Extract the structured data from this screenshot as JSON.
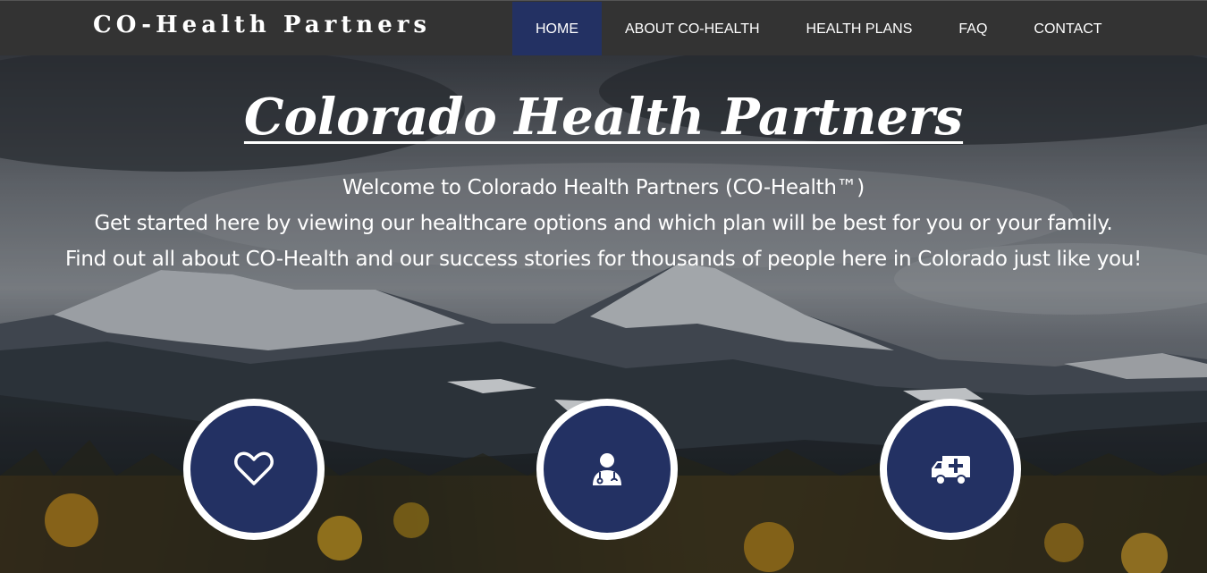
{
  "brand": {
    "name": "CO-Health Partners"
  },
  "nav": {
    "items": [
      {
        "label": "HOME",
        "active": true
      },
      {
        "label": "ABOUT CO-HEALTH"
      },
      {
        "label": "HEALTH PLANS"
      },
      {
        "label": "FAQ"
      },
      {
        "label": "CONTACT"
      }
    ]
  },
  "hero": {
    "title": "Colorado Health Partners",
    "lines": [
      "Welcome to Colorado Health Partners (CO-Health™)",
      "Get started here by viewing our healthcare options and which plan will be best for you or your family.",
      "Find out all about CO-Health and our success stories for thousands of people here in Colorado just like you!"
    ]
  },
  "feature_buttons": [
    {
      "icon": "heart-icon"
    },
    {
      "icon": "user-doctor-icon"
    },
    {
      "icon": "ambulance-icon"
    }
  ],
  "colors": {
    "navbar": "#333333",
    "nav_active": "#233163",
    "circle_fill": "#233163",
    "circle_border": "#ffffff",
    "text": "#ffffff"
  }
}
